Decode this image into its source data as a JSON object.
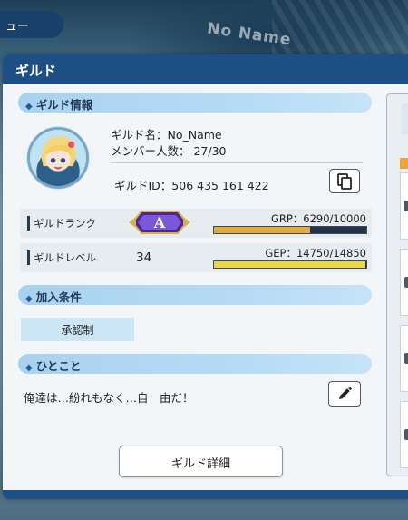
{
  "background": {
    "tab_label": "ュー",
    "decor_text": "No Name"
  },
  "modal": {
    "title": "ギルド",
    "section_info": "ギルド情報",
    "guild_name_line": "ギルド名：No_Name",
    "member_count_line": "メンバー人数： 27/30",
    "guild_id_line": "ギルドID：506 435 161 422",
    "rank": {
      "label": "ギルドランク",
      "badge_letter": "A",
      "caption": "GRP：6290/10000",
      "progress": 0.629,
      "fill_color": "#e2ad3c"
    },
    "level": {
      "label": "ギルドレベル",
      "value": "34",
      "caption": "GEP：14750/14850",
      "progress": 0.993,
      "fill_color": "#e9d94a"
    },
    "section_conditions": "加入条件",
    "condition_value": "承認制",
    "section_comment": "ひとこと",
    "comment": "俺達は…紛れもなく…自　由だ！",
    "detail_button": "ギルド詳細"
  },
  "colors": {
    "header": "#1d4f85",
    "section_bar": "#a9d2f0",
    "pill": "#cde6f6"
  },
  "icons": {
    "copy": "copy-icon",
    "edit": "pencil-icon",
    "section": "diamond-bullet-icon"
  }
}
